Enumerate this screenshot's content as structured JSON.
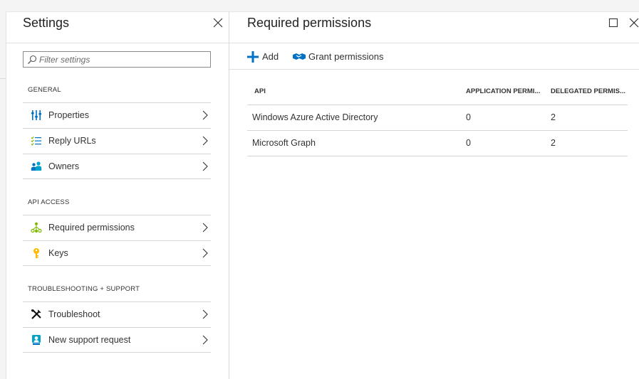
{
  "settings_blade": {
    "title": "Settings",
    "filter_placeholder": "Filter settings",
    "sections": [
      {
        "heading": "GENERAL",
        "items": [
          {
            "label": "Properties",
            "icon": "properties-icon"
          },
          {
            "label": "Reply URLs",
            "icon": "reply-urls-icon"
          },
          {
            "label": "Owners",
            "icon": "owners-icon"
          }
        ]
      },
      {
        "heading": "API ACCESS",
        "items": [
          {
            "label": "Required permissions",
            "icon": "required-permissions-icon"
          },
          {
            "label": "Keys",
            "icon": "key-icon"
          }
        ]
      },
      {
        "heading": "TROUBLESHOOTING + SUPPORT",
        "items": [
          {
            "label": "Troubleshoot",
            "icon": "troubleshoot-icon"
          },
          {
            "label": "New support request",
            "icon": "support-request-icon"
          }
        ]
      }
    ]
  },
  "permissions_blade": {
    "title": "Required permissions",
    "toolbar": {
      "add_label": "Add",
      "grant_label": "Grant permissions"
    },
    "table": {
      "columns": [
        "API",
        "APPLICATION PERMI...",
        "DELEGATED PERMIS..."
      ],
      "rows": [
        [
          "Windows Azure Active Directory",
          "0",
          "2"
        ],
        [
          "Microsoft Graph",
          "0",
          "2"
        ]
      ]
    }
  },
  "colors": {
    "accent": "#0072c6",
    "icon_green": "#7fba00",
    "icon_yellow": "#ffb900",
    "icon_teal": "#00a2c8"
  }
}
